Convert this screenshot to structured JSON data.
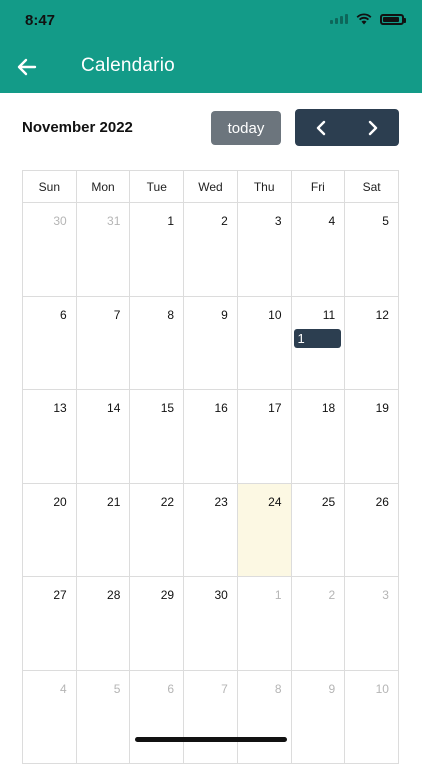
{
  "status": {
    "time": "8:47"
  },
  "header": {
    "title": "Calendario",
    "back_icon": "arrow-left-icon"
  },
  "toolbar": {
    "month_title": "November 2022",
    "today_label": "today",
    "prev_icon": "chevron-left-icon",
    "next_icon": "chevron-right-icon"
  },
  "colors": {
    "header": "#139b88",
    "today_button": "#6c757d",
    "nav_buttons": "#2c3e50",
    "event": "#2c3e50",
    "today_highlight": "#fcf8e3"
  },
  "calendar": {
    "weekdays": [
      "Sun",
      "Mon",
      "Tue",
      "Wed",
      "Thu",
      "Fri",
      "Sat"
    ],
    "weeks": [
      [
        "30",
        "31",
        "1",
        "2",
        "3",
        "4",
        "5"
      ],
      [
        "6",
        "7",
        "8",
        "9",
        "10",
        "11",
        "12"
      ],
      [
        "13",
        "14",
        "15",
        "16",
        "17",
        "18",
        "19"
      ],
      [
        "20",
        "21",
        "22",
        "23",
        "24",
        "25",
        "26"
      ],
      [
        "27",
        "28",
        "29",
        "30",
        "1",
        "2",
        "3"
      ],
      [
        "4",
        "5",
        "6",
        "7",
        "8",
        "9",
        "10"
      ]
    ],
    "event": {
      "label": "1"
    }
  }
}
